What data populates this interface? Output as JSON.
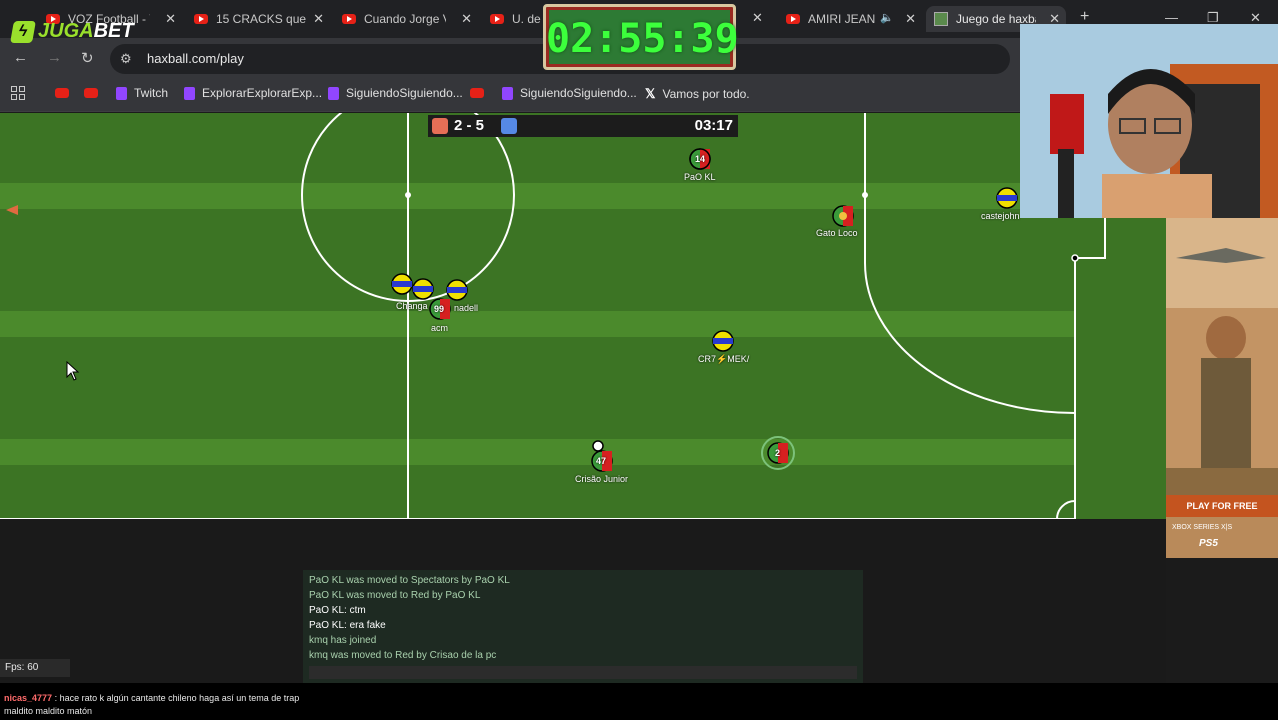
{
  "browser": {
    "tabs": [
      {
        "label": "VOZ Football - Y",
        "icon": "youtube-icon"
      },
      {
        "label": "15 CRACKS que",
        "icon": "youtube-icon"
      },
      {
        "label": "Cuando Jorge V",
        "icon": "youtube-icon"
      },
      {
        "label": "U. de C",
        "icon": "youtube-icon"
      },
      {
        "label": "AMIRI JEAN",
        "icon": "youtube-icon"
      },
      {
        "label": "Juego de haxba",
        "icon": "haxball-icon",
        "active": true
      }
    ],
    "url": "haxball.com/play",
    "bookmarks": [
      {
        "label": "",
        "icon": "youtube-icon"
      },
      {
        "label": "",
        "icon": "youtube-icon"
      },
      {
        "label": "Twitch",
        "icon": "twitch-icon"
      },
      {
        "label": "ExplorarExplorarExp...",
        "icon": "twitch-icon"
      },
      {
        "label": "SiguiendoSiguiendo...",
        "icon": "twitch-icon"
      },
      {
        "label": "",
        "icon": "youtube-icon"
      },
      {
        "label": "SiguiendoSiguiendo...",
        "icon": "twitch-icon"
      },
      {
        "label": "Vamos por todo.",
        "icon": "x-icon"
      }
    ]
  },
  "overlay": {
    "logo_left": "JUGA",
    "logo_right": "BET",
    "stream_timer": "02:55:39"
  },
  "game": {
    "score": "2 - 5",
    "clock": "03:17",
    "team_colors": {
      "red": "#e56e56",
      "blue": "#5689e5"
    },
    "players": {
      "p1": "PaO KL",
      "p2": "Gato Loco",
      "p3": "castejohn",
      "p4": "Changa",
      "p5": "nadell",
      "p6": "acm",
      "p7": "CR7⚡MEK/",
      "p8": "Crisão Junior"
    },
    "avatars": {
      "a1": "14",
      "a2": "99",
      "a3": "47",
      "a4": "2"
    }
  },
  "chat": {
    "lines": [
      {
        "who": "PaO KL",
        "text": "PaO KL was moved to Spectators by PaO KL"
      },
      {
        "who": "PaO KL",
        "text": "PaO KL was moved to Red by PaO KL"
      },
      {
        "who": "PaO KL",
        "text": "PaO KL: ctm"
      },
      {
        "who": "PaO KL",
        "text": "PaO KL: era fake"
      },
      {
        "who": "",
        "text": "kmq has joined"
      },
      {
        "who": "",
        "text": "kmq was moved to Red by Crisao de la pc"
      }
    ],
    "fps": "Fps: 60"
  },
  "stream_chat": {
    "user": "nicas_4777",
    "message": "hace rato k algún cantante chileno haga así un tema de trap",
    "message_cont": "maldito maldito matón"
  },
  "ad": {
    "button": "PLAY FOR FREE",
    "platforms": "XBOX SERIES X|S",
    "ps": "PS5"
  }
}
